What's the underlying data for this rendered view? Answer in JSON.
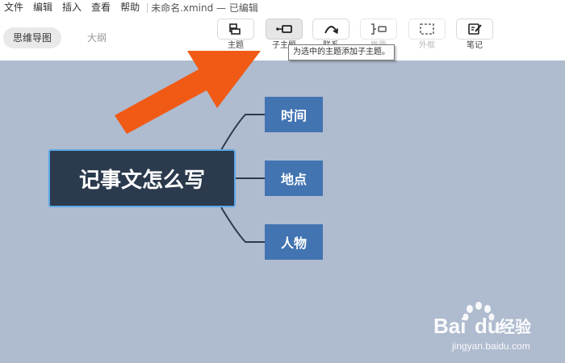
{
  "menu": {
    "items": [
      "文件",
      "编辑",
      "插入",
      "查看",
      "帮助"
    ],
    "document_title": "未命名.xmind — 已编辑"
  },
  "view_tabs": [
    {
      "label": "思维导图",
      "active": true
    },
    {
      "label": "大纲",
      "active": false
    }
  ],
  "tools": [
    {
      "label": "主题",
      "icon": "topic-icon",
      "state": "normal"
    },
    {
      "label": "子主题",
      "icon": "subtopic-icon",
      "state": "active"
    },
    {
      "label": "联系",
      "icon": "relationship-icon",
      "state": "normal"
    },
    {
      "label": "概要",
      "icon": "summary-icon",
      "state": "disabled"
    },
    {
      "label": "外框",
      "icon": "boundary-icon",
      "state": "disabled"
    },
    {
      "label": "笔记",
      "icon": "note-icon",
      "state": "normal"
    }
  ],
  "tooltip": "为选中的主题添加子主题。",
  "mindmap": {
    "root": "记事文怎么写",
    "children": [
      "时间",
      "地点",
      "人物"
    ]
  },
  "watermark": {
    "brand_left": "Bai",
    "brand_right": "du",
    "brand_cn": "经验",
    "url": "jingyan.baidu.com"
  },
  "colors": {
    "canvas_background": "#afbbcf",
    "root_topic": "#2b3a4d",
    "root_selection_border": "#5ea8e6",
    "sub_topic": "#4374b2",
    "arrow": "#f05a15"
  }
}
